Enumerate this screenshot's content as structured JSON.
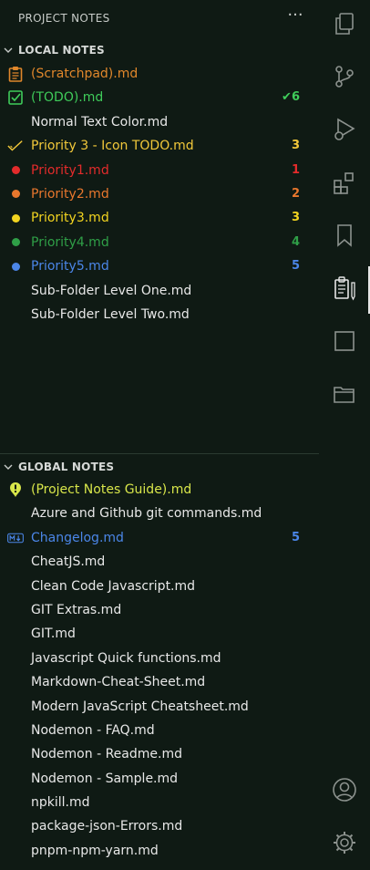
{
  "sidebar": {
    "title": "PROJECT NOTES",
    "more_label": "···",
    "local": {
      "header": "LOCAL NOTES",
      "items": [
        {
          "label": "(Scratchpad).md",
          "badge": "",
          "color": "#e0872b",
          "icon": "clipboard-icon"
        },
        {
          "label": "(TODO).md",
          "badge": "✔6",
          "color": "#3fcc5a",
          "icon": "checkbox-icon"
        },
        {
          "label": "Normal Text Color.md",
          "badge": "",
          "color": "#e8e8e8",
          "icon": ""
        },
        {
          "label": "Priority 3 - Icon TODO.md",
          "badge": "3",
          "color": "#f2c83a",
          "icon": "check-icon"
        },
        {
          "label": "Priority1.md",
          "badge": "1",
          "color": "#e32b2b",
          "icon": "red-dot-icon"
        },
        {
          "label": "Priority2.md",
          "badge": "2",
          "color": "#e8772d",
          "icon": "orange-dot-icon"
        },
        {
          "label": "Priority3.md",
          "badge": "3",
          "color": "#f2d420",
          "icon": "yellow-dot-icon"
        },
        {
          "label": "Priority4.md",
          "badge": "4",
          "color": "#2f9f47",
          "icon": "green-dot-icon"
        },
        {
          "label": "Priority5.md",
          "badge": "5",
          "color": "#4b86e8",
          "icon": "blue-dot-icon"
        },
        {
          "label": "Sub-Folder Level One.md",
          "badge": "",
          "color": "#e8e8e8",
          "icon": ""
        },
        {
          "label": "Sub-Folder Level Two.md",
          "badge": "",
          "color": "#e8e8e8",
          "icon": ""
        }
      ]
    },
    "global": {
      "header": "GLOBAL NOTES",
      "items": [
        {
          "label": "(Project Notes Guide).md",
          "badge": "",
          "color": "#d8e64a",
          "icon": "info-icon"
        },
        {
          "label": "Azure and Github git commands.md",
          "badge": "",
          "color": "#e8e8e8",
          "icon": ""
        },
        {
          "label": "Changelog.md",
          "badge": "5",
          "color": "#4b86e8",
          "icon": "markdown-icon"
        },
        {
          "label": "CheatJS.md",
          "badge": "",
          "color": "#e8e8e8",
          "icon": ""
        },
        {
          "label": "Clean Code Javascript.md",
          "badge": "",
          "color": "#e8e8e8",
          "icon": ""
        },
        {
          "label": "GIT Extras.md",
          "badge": "",
          "color": "#e8e8e8",
          "icon": ""
        },
        {
          "label": "GIT.md",
          "badge": "",
          "color": "#e8e8e8",
          "icon": ""
        },
        {
          "label": "Javascript Quick functions.md",
          "badge": "",
          "color": "#e8e8e8",
          "icon": ""
        },
        {
          "label": "Markdown-Cheat-Sheet.md",
          "badge": "",
          "color": "#e8e8e8",
          "icon": ""
        },
        {
          "label": "Modern JavaScript Cheatsheet.md",
          "badge": "",
          "color": "#e8e8e8",
          "icon": ""
        },
        {
          "label": "Nodemon - FAQ.md",
          "badge": "",
          "color": "#e8e8e8",
          "icon": ""
        },
        {
          "label": "Nodemon - Readme.md",
          "badge": "",
          "color": "#e8e8e8",
          "icon": ""
        },
        {
          "label": "Nodemon - Sample.md",
          "badge": "",
          "color": "#e8e8e8",
          "icon": ""
        },
        {
          "label": "npkill.md",
          "badge": "",
          "color": "#e8e8e8",
          "icon": ""
        },
        {
          "label": "package-json-Errors.md",
          "badge": "",
          "color": "#e8e8e8",
          "icon": ""
        },
        {
          "label": "pnpm-npm-yarn.md",
          "badge": "",
          "color": "#e8e8e8",
          "icon": ""
        }
      ]
    }
  },
  "activitybar": {
    "icons": [
      "explorer-icon",
      "source-control-icon",
      "run-debug-icon",
      "extensions-icon",
      "bookmarks-icon",
      "project-notes-icon",
      "empty-panel-icon",
      "folders-icon",
      "account-icon",
      "settings-gear-icon"
    ],
    "accent": "#e6e6e6"
  }
}
